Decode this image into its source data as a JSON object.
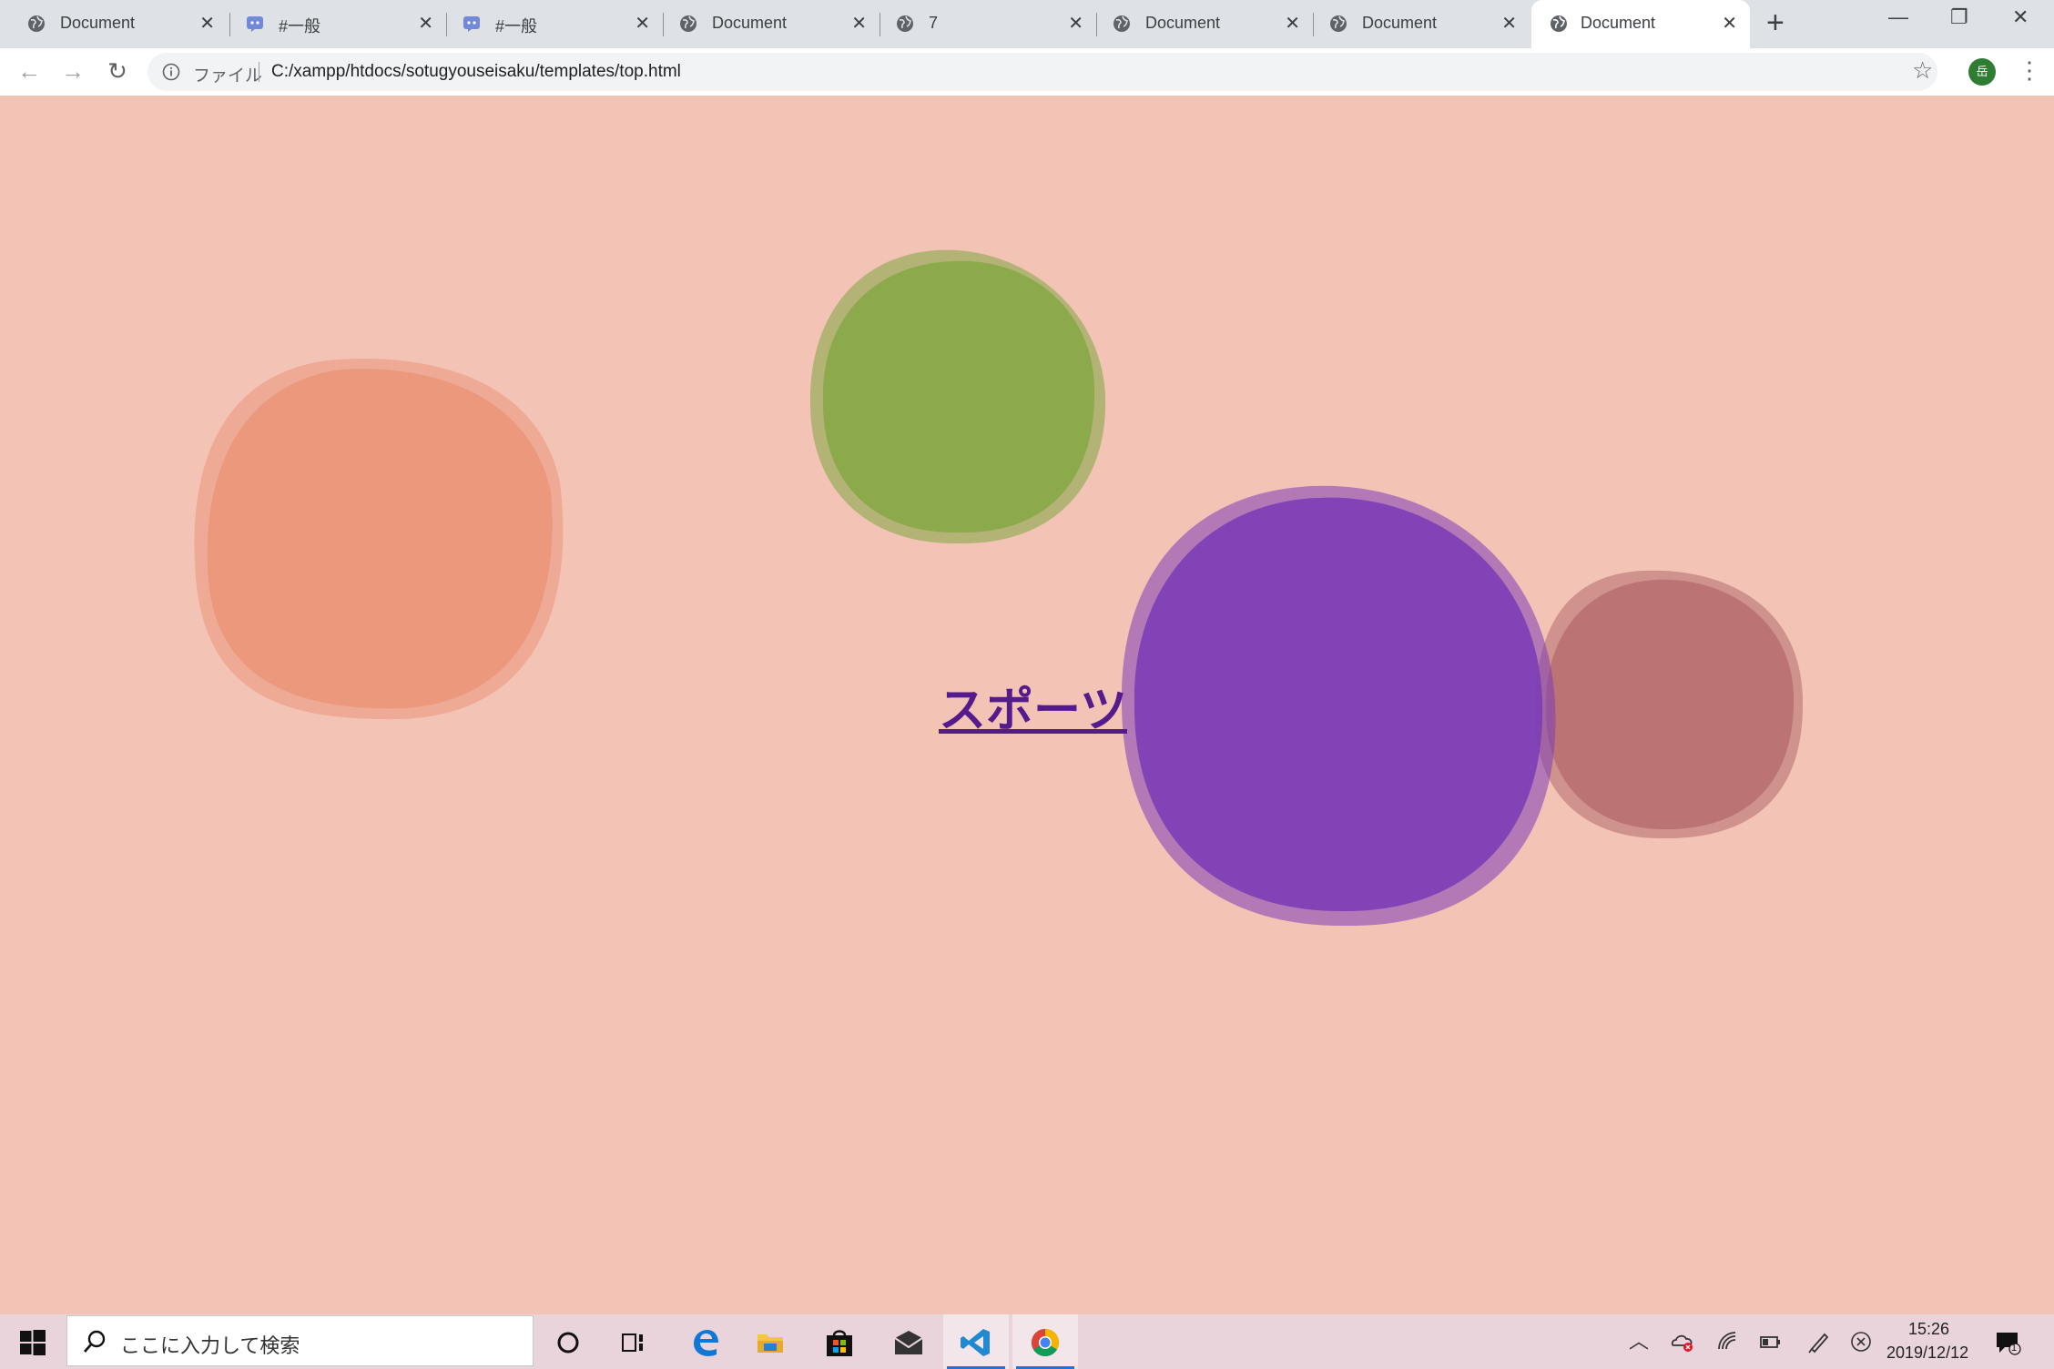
{
  "browser": {
    "tabs": [
      {
        "title": "Document",
        "icon": "globe-icon"
      },
      {
        "title": "#一般",
        "icon": "discord-icon"
      },
      {
        "title": "#一般",
        "icon": "discord-icon"
      },
      {
        "title": "Document",
        "icon": "globe-icon"
      },
      {
        "title": "7",
        "icon": "globe-icon"
      },
      {
        "title": "Document",
        "icon": "globe-icon"
      },
      {
        "title": "Document",
        "icon": "globe-icon"
      },
      {
        "title": "Document",
        "icon": "globe-icon",
        "active": true
      }
    ],
    "address": {
      "scheme_label": "ファイル",
      "url": "C:/xampp/htdocs/sotugyouseisaku/templates/top.html"
    },
    "profile_initial": "岳"
  },
  "page": {
    "background": "#f3c4b6",
    "link_text": "スポーツ",
    "link_color": "#551a8b",
    "blob_colors": [
      "#ea9679",
      "#87a847",
      "#7b3db6",
      "#b87170"
    ]
  },
  "taskbar": {
    "search_placeholder": "ここに入力して検索",
    "apps": [
      "cortana-icon",
      "task-view-icon",
      "edge-icon",
      "file-explorer-icon",
      "store-icon",
      "mail-icon",
      "vscode-icon",
      "chrome-icon"
    ],
    "time": "15:26",
    "date": "2019/12/12",
    "notification_count": "1"
  }
}
